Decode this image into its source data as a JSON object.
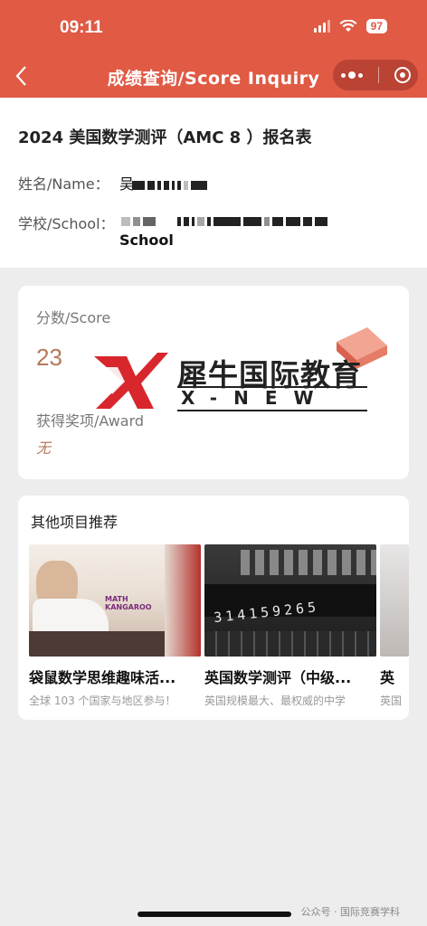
{
  "status": {
    "time": "09:11",
    "battery": "97"
  },
  "nav": {
    "title": "成绩查询/Score Inquiry",
    "back_icon": "chevron-left-icon"
  },
  "form": {
    "title": "2024 美国数学测评（AMC 8 ）报名表",
    "name_label": "姓名/Name：",
    "name_value": "吴",
    "school_label": "学校/School：",
    "school_value": "School"
  },
  "score": {
    "score_label": "分数/Score",
    "score_value": "23",
    "award_label": "获得奖项/Award",
    "award_value": "无"
  },
  "watermark": {
    "cn": "犀牛国际教育",
    "en": "X-NEW"
  },
  "recommend": {
    "title": "其他项目推荐",
    "items": [
      {
        "name": "袋鼠数学思维趣味活...",
        "desc": "全球 103 个国家与地区参与！",
        "img_text": "MATH KANGAROO"
      },
      {
        "name": "英国数学测评（中级...",
        "desc": "英国规模最大、最权威的中学",
        "img_text": "314159265"
      },
      {
        "name": "英",
        "desc": "英国"
      }
    ]
  },
  "footer": {
    "text": "公众号 · 国际竞赛学科"
  },
  "colors": {
    "brand": "#e05a44",
    "accent": "#b6785a"
  }
}
